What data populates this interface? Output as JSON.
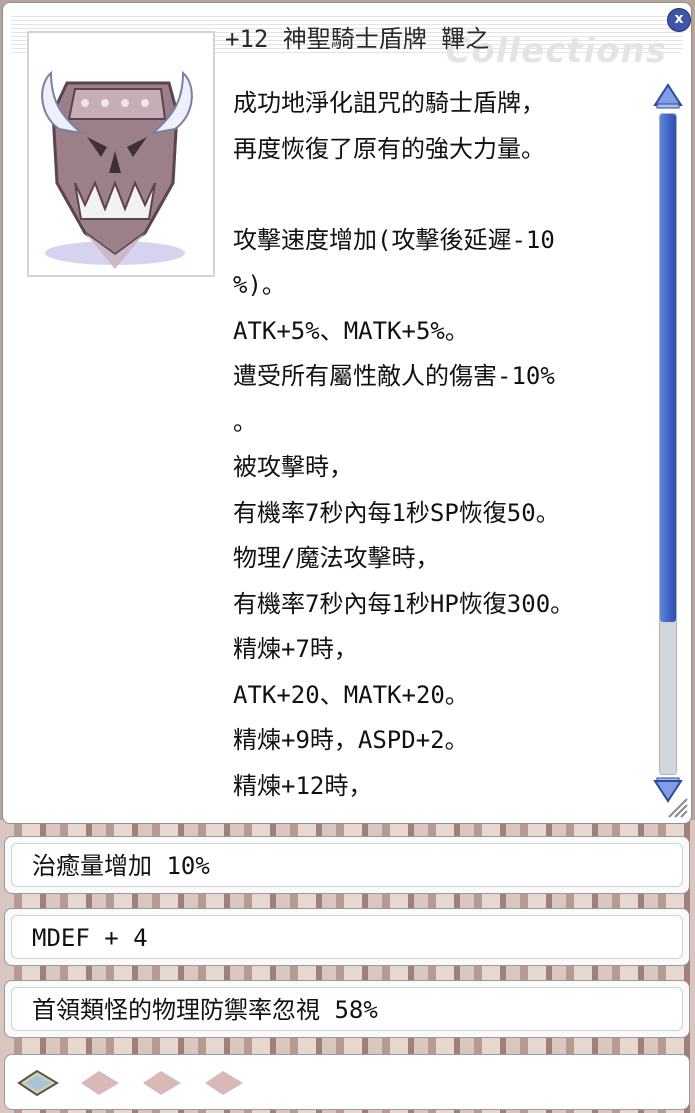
{
  "window": {
    "title": "+12 神聖騎士盾牌 鞸之",
    "watermark": "Collections",
    "close_label": "x"
  },
  "item": {
    "icon": "holy-knight-shield-icon",
    "description_lines": [
      "成功地淨化詛咒的騎士盾牌，",
      "再度恢復了原有的強大力量。",
      "",
      "攻擊速度增加(攻擊後延遲-10",
      "%)。",
      "ATK+5%、MATK+5%。",
      "遭受所有屬性敵人的傷害-10%",
      "。",
      "被攻擊時，",
      "有機率7秒內每1秒SP恢復50。",
      "物理/魔法攻擊時，",
      "有機率7秒內每1秒HP恢復300。",
      "精煉+7時，",
      "ATK+20、MATK+20。",
      "精煉+9時，ASPD+2。",
      "精煉+12時，"
    ]
  },
  "scroll": {
    "position_fraction": 0.0,
    "visible_fraction": 0.77
  },
  "options": [
    {
      "text": "治癒量增加 10%"
    },
    {
      "text": "MDEF + 4"
    },
    {
      "text": "首領類怪的物理防禦率忽視 58%"
    }
  ],
  "slots": [
    {
      "icon": "card-slot-filled-icon",
      "filled": true
    },
    {
      "icon": "card-slot-empty-icon",
      "filled": false
    },
    {
      "icon": "card-slot-empty-icon",
      "filled": false
    },
    {
      "icon": "card-slot-empty-icon",
      "filled": false
    }
  ],
  "colors": {
    "scroll_thumb": "#3b62c6",
    "close_button": "#3f56a8",
    "empty_slot": "#d9b8b8"
  }
}
